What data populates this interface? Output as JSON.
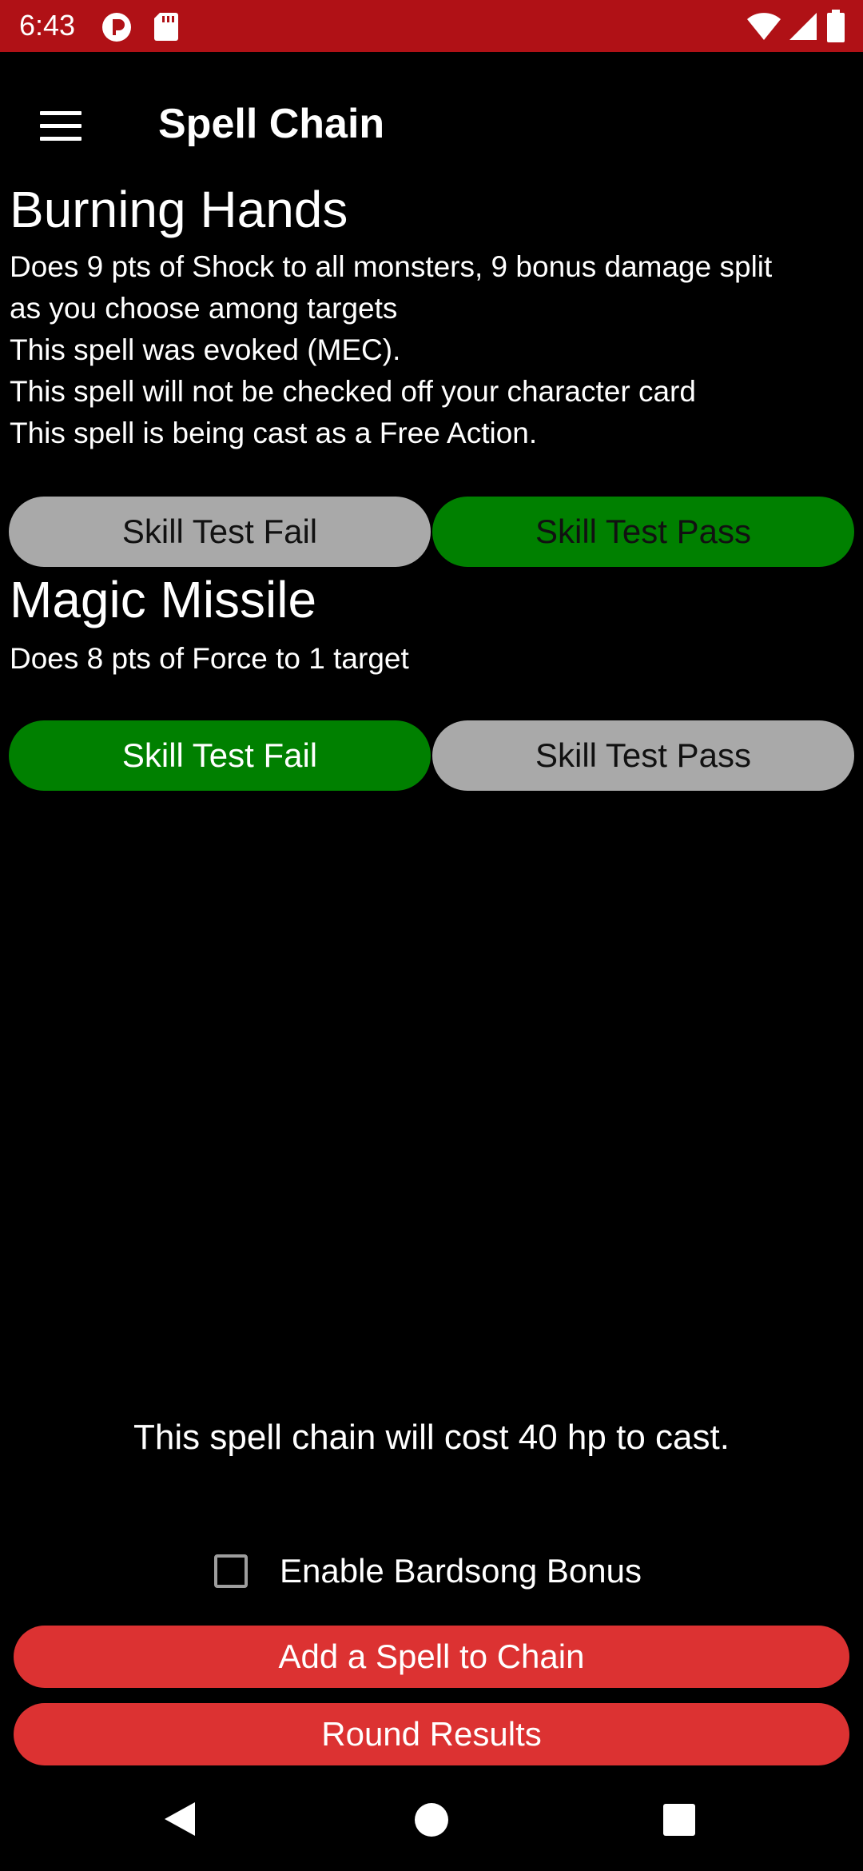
{
  "status_bar": {
    "time": "6:43",
    "background": "#b01116",
    "icons": [
      "notification-app-icon",
      "sd-card-icon",
      "wifi-icon",
      "signal-icon",
      "battery-icon"
    ]
  },
  "app_bar": {
    "title": "Spell Chain",
    "menu_icon": "hamburger-menu-icon"
  },
  "spells": [
    {
      "name": "Burning Hands",
      "description_lines": [
        "Does 9 pts of Shock to all monsters, 9 bonus damage split",
        "as you choose among targets",
        "This spell was evoked (MEC).",
        "This spell will not be checked off your character card",
        "This spell is being cast as a Free Action."
      ],
      "fail_label": "Skill Test Fail",
      "pass_label": "Skill Test Pass",
      "selected": "pass"
    },
    {
      "name": "Magic Missile",
      "description_lines": [
        "Does 8 pts of Force to 1 target"
      ],
      "fail_label": "Skill Test Fail",
      "pass_label": "Skill Test Pass",
      "selected": "fail"
    }
  ],
  "footer": {
    "cost_text": "This spell chain will cost 40 hp to cast.",
    "bardsong_label": "Enable Bardsong Bonus",
    "bardsong_checked": false,
    "add_spell_label": "Add a Spell to Chain",
    "round_results_label": "Round Results"
  },
  "colors": {
    "accent_red": "#dc3232",
    "selected_green": "#008000",
    "unselected_gray": "#a9a9a9",
    "background": "#000000"
  },
  "nav_bar": {
    "icons": [
      "back-icon",
      "home-icon",
      "recents-icon"
    ]
  }
}
